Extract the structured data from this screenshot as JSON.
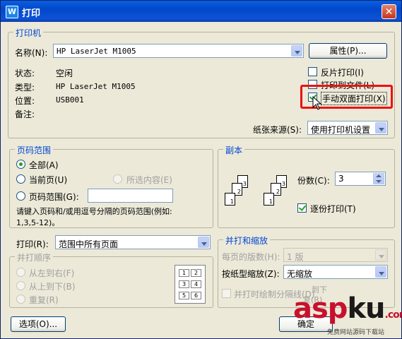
{
  "window": {
    "title": "打印",
    "app_icon": "W",
    "close_glyph": "✕"
  },
  "printer": {
    "group_label": "打印机",
    "name_label": "名称(N):",
    "name_value": "HP LaserJet M1005",
    "properties_button": "属性(P)...",
    "status_label": "状态:",
    "status_value": "空闲",
    "type_label": "类型:",
    "type_value": "HP LaserJet M1005",
    "location_label": "位置:",
    "location_value": "USB001",
    "comment_label": "备注:",
    "reverse_print": "反片打印(I)",
    "print_to_file": "打印到文件(L)",
    "manual_duplex": "手动双面打印(X)",
    "paper_source_label": "纸张来源(S):",
    "paper_source_value": "使用打印机设置"
  },
  "page_range": {
    "group_label": "页码范围",
    "all": "全部(A)",
    "current": "当前页(U)",
    "selection": "所选内容(E)",
    "pages": "页码范围(G):",
    "pages_value": "",
    "hint": "请键入页码和/或用逗号分隔的页码范围(例如:",
    "hint_example": "1,3,5-12)。"
  },
  "copies": {
    "group_label": "副本",
    "count_label": "份数(C):",
    "count_value": "3",
    "collate": "逐份打印(T)",
    "page_numbers": [
      "1",
      "2",
      "3",
      "1",
      "2",
      "3"
    ]
  },
  "print_what": {
    "label": "打印(R):",
    "value": "范围中所有页面"
  },
  "print_order": {
    "group_label": "并打顺序",
    "left_to_right": "从左到右(F)",
    "top_to_bottom": "从上到下(B)",
    "repeat": "重复(R)",
    "preview_cells": [
      "1",
      "2",
      "3",
      "4",
      "5",
      "6"
    ]
  },
  "zoom": {
    "group_label": "并打和缩放",
    "pages_per_sheet_label": "每页的版数(H):",
    "pages_per_sheet_value": "1 版",
    "scale_label": "按纸型缩放(Z):",
    "scale_value": "无缩放",
    "draw_separator": "并打时绘制分隔线(D)",
    "overlap_text_1": "到下",
    "overlap_text_2": "复(R)"
  },
  "footer": {
    "options_button": "选项(O)...",
    "ok_button": "确定"
  },
  "watermark": {
    "logo_a": "asp",
    "logo_b": "ku",
    "logo_c": ".com",
    "subtitle": "免费网站源码下载站"
  },
  "colors": {
    "title_blue": "#0347c9",
    "legend_blue": "#0046d5",
    "highlight_red": "#e11111",
    "check_green": "#21a121"
  }
}
